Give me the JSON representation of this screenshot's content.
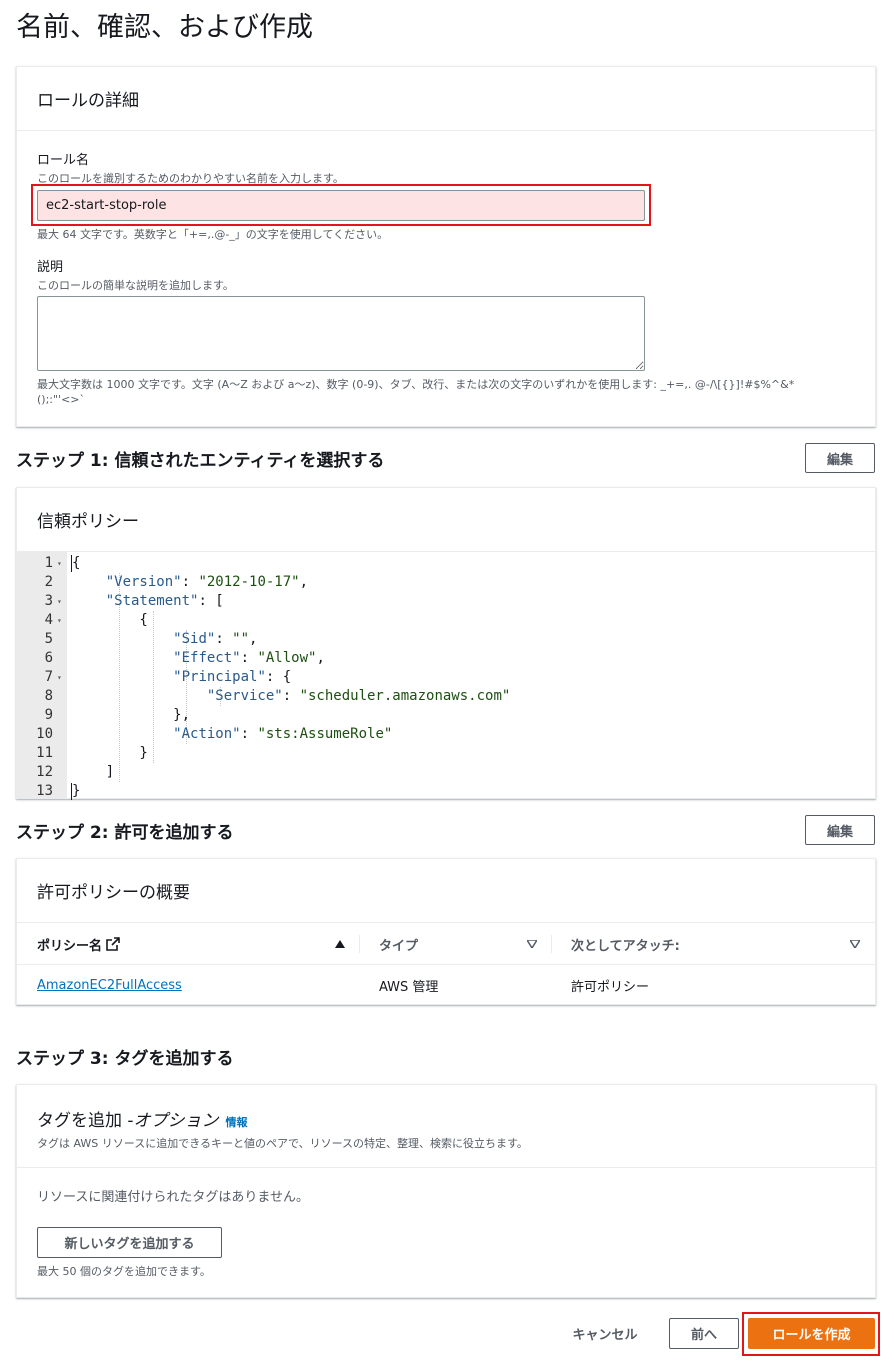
{
  "page": {
    "title": "名前、確認、および作成"
  },
  "role_details": {
    "heading": "ロールの詳細",
    "name_label": "ロール名",
    "name_desc": "このロールを識別するためのわかりやすい名前を入力します。",
    "name_value": "ec2-start-stop-role",
    "name_hint": "最大 64 文字です。英数字と「+=,.@-_」の文字を使用してください。",
    "desc_label": "説明",
    "desc_desc": "このロールの簡単な説明を追加します。",
    "desc_value": "",
    "desc_hint_1": "最大文字数は 1000 文字です。文字 (A〜Z および a〜z)、数字 (0-9)、タブ、改行、または次の文字のいずれかを使用します: _+=,. @-/\\[{}]!#$%^&*",
    "desc_hint_2": "();:\"'<>`"
  },
  "step1": {
    "title": "ステップ 1: 信頼されたエンティティを選択する",
    "edit_label": "編集",
    "panel_heading": "信頼ポリシー",
    "code_lines": [
      {
        "n": "1",
        "fold": true,
        "text": "{"
      },
      {
        "n": "2",
        "fold": false,
        "key": "\"Version\"",
        "sep": ": ",
        "val": "\"2012-10-17\"",
        "tail": ",",
        "indent": "    "
      },
      {
        "n": "3",
        "fold": true,
        "key": "\"Statement\"",
        "sep": ": ",
        "val": "",
        "tail": "[",
        "indent": "    "
      },
      {
        "n": "4",
        "fold": true,
        "text": "        {"
      },
      {
        "n": "5",
        "fold": false,
        "key": "\"Sid\"",
        "sep": ": ",
        "val": "\"\"",
        "tail": ",",
        "indent": "            "
      },
      {
        "n": "6",
        "fold": false,
        "key": "\"Effect\"",
        "sep": ": ",
        "val": "\"Allow\"",
        "tail": ",",
        "indent": "            "
      },
      {
        "n": "7",
        "fold": true,
        "key": "\"Principal\"",
        "sep": ": ",
        "val": "",
        "tail": "{",
        "indent": "            "
      },
      {
        "n": "8",
        "fold": false,
        "key": "\"Service\"",
        "sep": ": ",
        "val": "\"scheduler.amazonaws.com\"",
        "tail": "",
        "indent": "                "
      },
      {
        "n": "9",
        "fold": false,
        "text": "            },"
      },
      {
        "n": "10",
        "fold": false,
        "key": "\"Action\"",
        "sep": ": ",
        "val": "\"sts:AssumeRole\"",
        "tail": "",
        "indent": "            "
      },
      {
        "n": "11",
        "fold": false,
        "text": "        }"
      },
      {
        "n": "12",
        "fold": false,
        "text": "    ]"
      },
      {
        "n": "13",
        "fold": false,
        "text": "}"
      }
    ]
  },
  "step2": {
    "title": "ステップ 2: 許可を追加する",
    "edit_label": "編集",
    "panel_heading": "許可ポリシーの概要",
    "columns": [
      "ポリシー名",
      "タイプ",
      "次としてアタッチ:"
    ],
    "rows": [
      {
        "name": "AmazonEC2FullAccess",
        "type": "AWS 管理",
        "attached_as": "許可ポリシー"
      }
    ]
  },
  "step3": {
    "title": "ステップ 3: タグを追加する",
    "panel_heading": "タグを追加 - ",
    "panel_heading_optional": "オプション",
    "info_link": "情報",
    "panel_desc": "タグは AWS リソースに追加できるキーと値のペアで、リソースの特定、整理、検索に役立ちます。",
    "empty_text": "リソースに関連付けられたタグはありません。",
    "add_tag_button": "新しいタグを追加する",
    "add_tag_hint": "最大 50 個のタグを追加できます。"
  },
  "footer": {
    "cancel": "キャンセル",
    "previous": "前へ",
    "create": "ロールを作成"
  },
  "colors": {
    "primary": "#ec7211",
    "link": "#0073bb",
    "highlight": "#e4141b",
    "input_error_bg": "#fde3e3"
  }
}
